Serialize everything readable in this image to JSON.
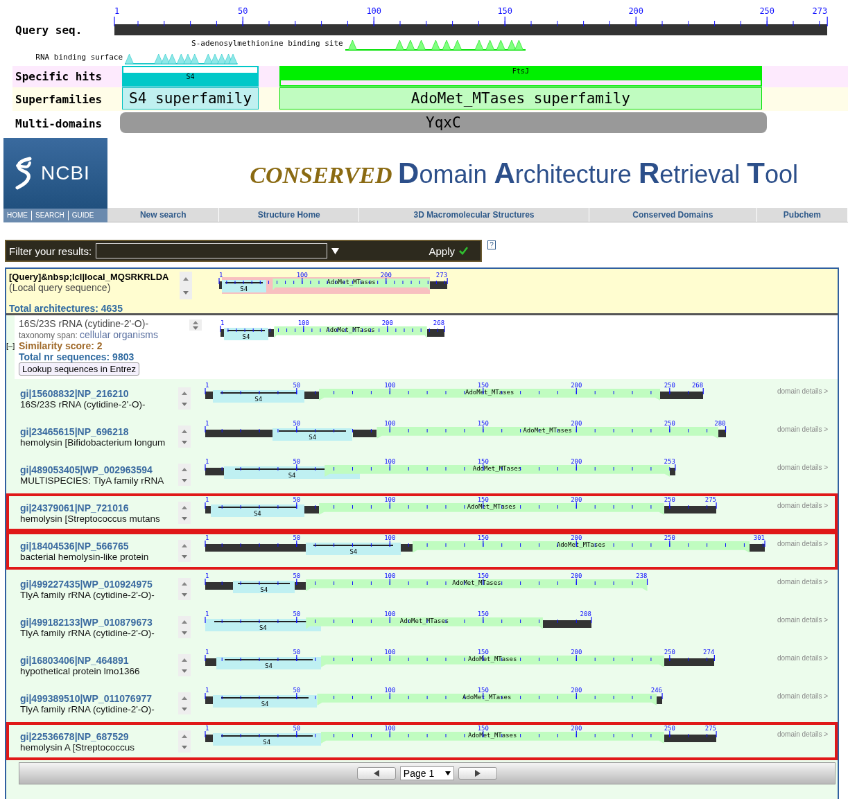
{
  "overview": {
    "ruler_label": "Query seq.",
    "ticks": [
      "1",
      "50",
      "100",
      "150",
      "200",
      "250",
      "273"
    ],
    "features": [
      {
        "label": "S-adenosylmethionine binding site",
        "kind": "site"
      },
      {
        "label": "RNA binding surface",
        "kind": "surface"
      }
    ],
    "tracks": [
      {
        "label": "Specific hits",
        "kind": "hits",
        "domains": [
          {
            "label": "S4",
            "kind": "s4"
          },
          {
            "label": "FtsJ",
            "kind": "ftsj"
          }
        ]
      },
      {
        "label": "Superfamilies",
        "kind": "superfamily",
        "domains": [
          {
            "label": "S4 superfamily",
            "kind": "s4"
          },
          {
            "label": "AdoMet_MTases superfamily",
            "kind": "ftsj"
          }
        ]
      },
      {
        "label": "Multi-domains",
        "kind": "multi",
        "domains": [
          {
            "label": "YqxC",
            "kind": "multi"
          }
        ]
      }
    ]
  },
  "header": {
    "logo": "NCBI",
    "logo_links": [
      "HOME",
      "SEARCH",
      "GUIDE"
    ],
    "title": [
      {
        "text": "CONSERVED ",
        "kind": "brand"
      },
      {
        "text": "D",
        "kind": "cap"
      },
      {
        "text": "omain ",
        "kind": "plain"
      },
      {
        "text": "A",
        "kind": "cap"
      },
      {
        "text": "rchitecture ",
        "kind": "plain"
      },
      {
        "text": "R",
        "kind": "cap"
      },
      {
        "text": "etrieval ",
        "kind": "plain"
      },
      {
        "text": "T",
        "kind": "cap"
      },
      {
        "text": "ool",
        "kind": "plain"
      }
    ],
    "nav": [
      "New search",
      "Structure Home",
      "3D Macromolecular Structures",
      "Conserved Domains",
      "Pubchem"
    ]
  },
  "filter": {
    "label": "Filter your results:",
    "apply": "Apply",
    "help": "?"
  },
  "query": {
    "title": "[Query]&nbsp;lcl|local_MQSRKRLDA",
    "subtitle": "(Local query sequence)",
    "total": "Total architectures: 4635",
    "ticks": [
      "1",
      "100",
      "200",
      "273"
    ],
    "segments": [
      {
        "kind": "hit"
      },
      {
        "kind": "seq"
      },
      {
        "kind": "s4",
        "label": "S4"
      },
      {
        "kind": "adomet",
        "label": "AdoMet_MTases"
      },
      {
        "kind": "seq"
      }
    ]
  },
  "group": {
    "title": "16S/23S rRNA (cytidine-2'-O)-",
    "taxonomy_label": "taxonomy span:",
    "taxonomy": "cellular organisms",
    "collapse": "[–]",
    "score": "Similarity score: 2",
    "total": "Total nr sequences: 9803",
    "lookup": "Lookup sequences in Entrez",
    "ticks": [
      "1",
      "100",
      "200",
      "268"
    ],
    "segments": [
      {
        "kind": "seq"
      },
      {
        "kind": "s4",
        "label": "S4"
      },
      {
        "kind": "seq"
      },
      {
        "kind": "adomet",
        "label": "AdoMet_MTases"
      },
      {
        "kind": "seq"
      }
    ]
  },
  "rows": [
    {
      "id": "gi|15608832|NP_216210",
      "desc": "16S/23S rRNA (cytidine-2'-O)-",
      "highlighted": false,
      "details": "domain details >",
      "ticks": [
        "1",
        "50",
        "100",
        "150",
        "200",
        "250",
        "268"
      ],
      "segments": [
        {
          "kind": "seq"
        },
        {
          "kind": "s4",
          "label": "S4"
        },
        {
          "kind": "seq"
        },
        {
          "kind": "adomet",
          "label": "AdoMet_MTases"
        },
        {
          "kind": "seq"
        }
      ]
    },
    {
      "id": "gi|23465615|NP_696218",
      "desc": "hemolysin [Bifidobacterium longum",
      "highlighted": false,
      "details": "domain details >",
      "ticks": [
        "1",
        "50",
        "100",
        "150",
        "200",
        "250",
        "280"
      ],
      "segments": [
        {
          "kind": "seq"
        },
        {
          "kind": "s4",
          "label": "S4"
        },
        {
          "kind": "seq"
        },
        {
          "kind": "adomet",
          "label": "AdoMet_MTases"
        },
        {
          "kind": "seq"
        }
      ]
    },
    {
      "id": "gi|489053405|WP_002963594",
      "desc": "MULTISPECIES: TlyA family rRNA",
      "highlighted": false,
      "details": "domain details >",
      "ticks": [
        "1",
        "50",
        "100",
        "150",
        "200",
        "253"
      ],
      "segments": [
        {
          "kind": "seq"
        },
        {
          "kind": "s4",
          "label": "S4"
        },
        {
          "kind": "adomet",
          "label": "AdoMet_MTases"
        },
        {
          "kind": "seq"
        }
      ]
    },
    {
      "id": "gi|24379061|NP_721016",
      "desc": "hemolysin [Streptococcus mutans",
      "highlighted": true,
      "details": "domain details >",
      "ticks": [
        "1",
        "50",
        "100",
        "150",
        "200",
        "250",
        "275"
      ],
      "segments": [
        {
          "kind": "seq"
        },
        {
          "kind": "s4",
          "label": "S4"
        },
        {
          "kind": "seq"
        },
        {
          "kind": "adomet",
          "label": "AdoMet_MTases"
        },
        {
          "kind": "seq"
        }
      ]
    },
    {
      "id": "gi|18404536|NP_566765",
      "desc": "bacterial hemolysin-like protein",
      "highlighted": true,
      "details": "domain details >",
      "ticks": [
        "1",
        "50",
        "100",
        "150",
        "200",
        "250",
        "301"
      ],
      "segments": [
        {
          "kind": "seq"
        },
        {
          "kind": "s4",
          "label": "S4"
        },
        {
          "kind": "seq"
        },
        {
          "kind": "adomet",
          "label": "AdoMet_MTases"
        },
        {
          "kind": "seq"
        }
      ]
    },
    {
      "id": "gi|499227435|WP_010924975",
      "desc": "TlyA family rRNA (cytidine-2'-O)-",
      "highlighted": false,
      "details": "domain details >",
      "ticks": [
        "1",
        "50",
        "100",
        "150",
        "200",
        "238"
      ],
      "segments": [
        {
          "kind": "seq"
        },
        {
          "kind": "s4",
          "label": "S4"
        },
        {
          "kind": "seq"
        },
        {
          "kind": "adomet",
          "label": "AdoMet_MTases"
        }
      ]
    },
    {
      "id": "gi|499182133|WP_010879673",
      "desc": "TlyA family rRNA (cytidine-2'-O)-",
      "highlighted": false,
      "details": "domain details >",
      "ticks": [
        "1",
        "50",
        "100",
        "150",
        "208"
      ],
      "segments": [
        {
          "kind": "s4",
          "label": "S4"
        },
        {
          "kind": "adomet",
          "label": "AdoMet_MTases"
        },
        {
          "kind": "seq"
        }
      ]
    },
    {
      "id": "gi|16803406|NP_464891",
      "desc": "hypothetical protein lmo1366",
      "highlighted": false,
      "details": "domain details >",
      "ticks": [
        "1",
        "50",
        "100",
        "150",
        "200",
        "250",
        "274"
      ],
      "segments": [
        {
          "kind": "seq"
        },
        {
          "kind": "s4",
          "label": "S4"
        },
        {
          "kind": "adomet",
          "label": "AdoMet_MTases"
        },
        {
          "kind": "seq"
        }
      ]
    },
    {
      "id": "gi|499389510|WP_011076977",
      "desc": "TlyA family rRNA (cytidine-2'-O)-",
      "highlighted": false,
      "details": "domain details >",
      "ticks": [
        "1",
        "50",
        "100",
        "150",
        "200",
        "246"
      ],
      "segments": [
        {
          "kind": "seq"
        },
        {
          "kind": "s4",
          "label": "S4"
        },
        {
          "kind": "adomet",
          "label": "AdoMet_MTases"
        },
        {
          "kind": "seq"
        }
      ]
    },
    {
      "id": "gi|22536678|NP_687529",
      "desc": "hemolysin A [Streptococcus",
      "highlighted": true,
      "details": "domain details >",
      "ticks": [
        "1",
        "50",
        "100",
        "150",
        "200",
        "250",
        "275"
      ],
      "segments": [
        {
          "kind": "seq"
        },
        {
          "kind": "s4",
          "label": "S4"
        },
        {
          "kind": "adomet",
          "label": "AdoMet_MTases"
        },
        {
          "kind": "seq"
        }
      ]
    }
  ],
  "pager": {
    "page": "Page 1"
  }
}
